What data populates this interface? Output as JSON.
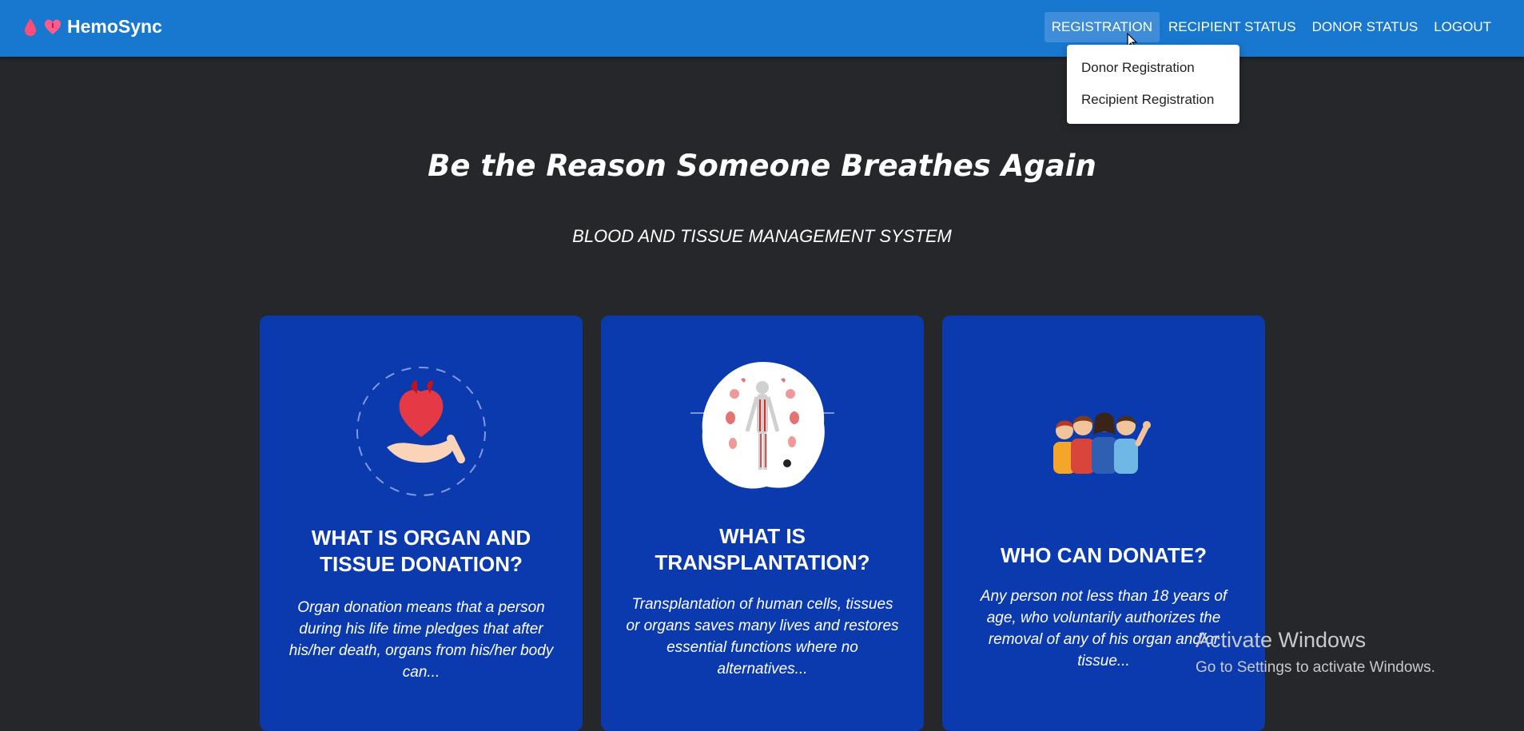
{
  "brand": {
    "name": "HemoSync"
  },
  "nav": {
    "registration": "REGISTRATION",
    "recipient_status": "RECIPIENT STATUS",
    "donor_status": "DONOR STATUS",
    "logout": "LOGOUT"
  },
  "dropdown": {
    "items": [
      "Donor Registration",
      "Recipient Registration"
    ]
  },
  "hero": {
    "title": "Be the Reason Someone Breathes Again",
    "subtitle": "BLOOD AND TISSUE MANAGEMENT SYSTEM"
  },
  "cards": [
    {
      "title": "WHAT IS ORGAN AND TISSUE DONATION?",
      "text": "Organ donation means that a person during his life time pledges that after his/her death, organs from his/her body can..."
    },
    {
      "title": "WHAT IS TRANSPLANTATION?",
      "text": "Transplantation of human cells, tissues or organs saves many lives and restores essential functions where no alternatives..."
    },
    {
      "title": "WHO CAN DONATE?",
      "text": "Any person not less than 18 years of age, who voluntarily authorizes the removal of any of his organ and/or tissue..."
    }
  ],
  "watermark": {
    "title": "Activate Windows",
    "subtitle": "Go to Settings to activate Windows."
  },
  "colors": {
    "navbar": "#1877cf",
    "background": "#25272b",
    "card": "#0b3aae"
  },
  "icons": [
    "blood-drop-icon",
    "heart-icon",
    "heart-in-hand-icon",
    "human-organs-icon",
    "people-group-icon",
    "mouse-cursor-icon"
  ]
}
